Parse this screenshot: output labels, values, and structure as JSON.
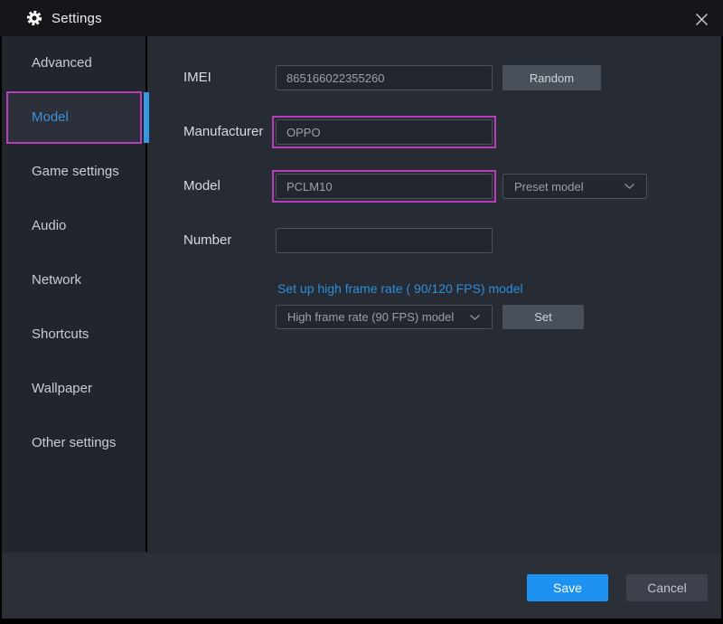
{
  "window": {
    "title": "Settings"
  },
  "sidebar": {
    "items": [
      {
        "label": "Advanced",
        "selected": false
      },
      {
        "label": "Model",
        "selected": true
      },
      {
        "label": "Game settings",
        "selected": false
      },
      {
        "label": "Audio",
        "selected": false
      },
      {
        "label": "Network",
        "selected": false
      },
      {
        "label": "Shortcuts",
        "selected": false
      },
      {
        "label": "Wallpaper",
        "selected": false
      },
      {
        "label": "Other settings",
        "selected": false
      }
    ]
  },
  "form": {
    "imei": {
      "label": "IMEI",
      "value": "865166022355260",
      "random_label": "Random"
    },
    "manufacturer": {
      "label": "Manufacturer",
      "value": "OPPO"
    },
    "model": {
      "label": "Model",
      "value": "PCLM10",
      "preset_dropdown": "Preset model"
    },
    "number": {
      "label": "Number",
      "value": ""
    },
    "high_frame_rate": {
      "link": "Set up high frame rate ( 90/120 FPS) model",
      "dropdown": "High frame rate (90 FPS) model",
      "set_label": "Set"
    }
  },
  "footer": {
    "save_label": "Save",
    "cancel_label": "Cancel"
  },
  "colors": {
    "highlight_magenta": "#b93cbc",
    "selected_blue": "#3f8fdb",
    "link_blue": "#2e8fdb",
    "save_blue": "#1d92f0",
    "selection_bar_blue": "#3399e0"
  }
}
